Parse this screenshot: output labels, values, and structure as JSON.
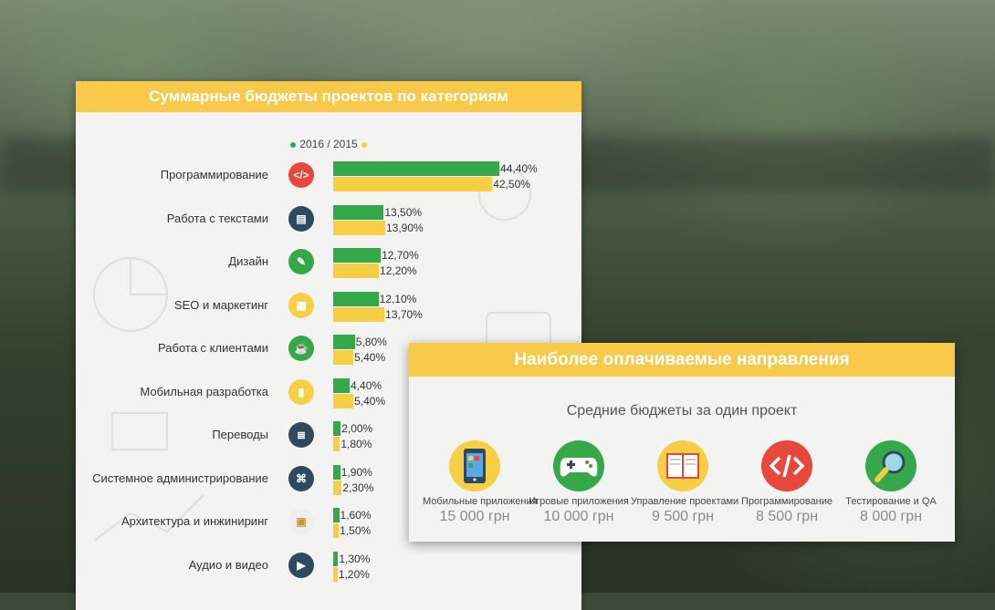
{
  "colors": {
    "green": "#35a84a",
    "yellow": "#f7cf46",
    "header": "#f9c94a"
  },
  "chart_data": [
    {
      "type": "bar",
      "title": "Суммарные бюджеты проектов по категориям",
      "legend": {
        "text": "2016 / 2015",
        "placement": "top-center"
      },
      "categories": [
        "Программирование",
        "Работа с текстами",
        "Дизайн",
        "SEO и маркетинг",
        "Работа с клиентами",
        "Мобильная разработка",
        "Переводы",
        "Системное администрирование",
        "Архитектура и инжиниринг",
        "Аудио и видео"
      ],
      "icons": [
        "code-icon",
        "document-icon",
        "pencils-icon",
        "presentation-icon",
        "cup-icon",
        "phone-icon",
        "books-icon",
        "network-icon",
        "box-icon",
        "clapperboard-icon"
      ],
      "series": [
        {
          "name": "2016",
          "values": [
            44.4,
            13.5,
            12.7,
            12.1,
            5.8,
            4.4,
            2.0,
            1.9,
            1.6,
            1.3
          ],
          "labels": [
            "44,40%",
            "13,50%",
            "12,70%",
            "12,10%",
            "5,80%",
            "4,40%",
            "2,00%",
            "1,90%",
            "1,60%",
            "1,30%"
          ]
        },
        {
          "name": "2015",
          "values": [
            42.5,
            13.9,
            12.2,
            13.7,
            5.4,
            5.4,
            1.8,
            2.3,
            1.5,
            1.2
          ],
          "labels": [
            "42,50%",
            "13,90%",
            "12,20%",
            "13,70%",
            "5,40%",
            "5,40%",
            "1,80%",
            "2,30%",
            "1,50%",
            "1,20%"
          ]
        }
      ]
    },
    {
      "type": "table",
      "title": "Наиболее оплачиваемые направления",
      "subtitle": "Средние бюджеты за один проект",
      "items": [
        {
          "name": "Мобильные приложения",
          "price": "15 000 грн",
          "icon": "smartphone-icon",
          "color": "#f7cf46"
        },
        {
          "name": "Игровые приложения",
          "price": "10 000 грн",
          "icon": "gamepad-icon",
          "color": "#35a84a"
        },
        {
          "name": "Управление проектами",
          "price": "9 500 грн",
          "icon": "planner-icon",
          "color": "#f7cf46"
        },
        {
          "name": "Программирование",
          "price": "8 500 грн",
          "icon": "code-icon",
          "color": "#e8473b"
        },
        {
          "name": "Тестирование и QA",
          "price": "8 000 грн",
          "icon": "magnifier-icon",
          "color": "#35a84a"
        }
      ]
    }
  ]
}
